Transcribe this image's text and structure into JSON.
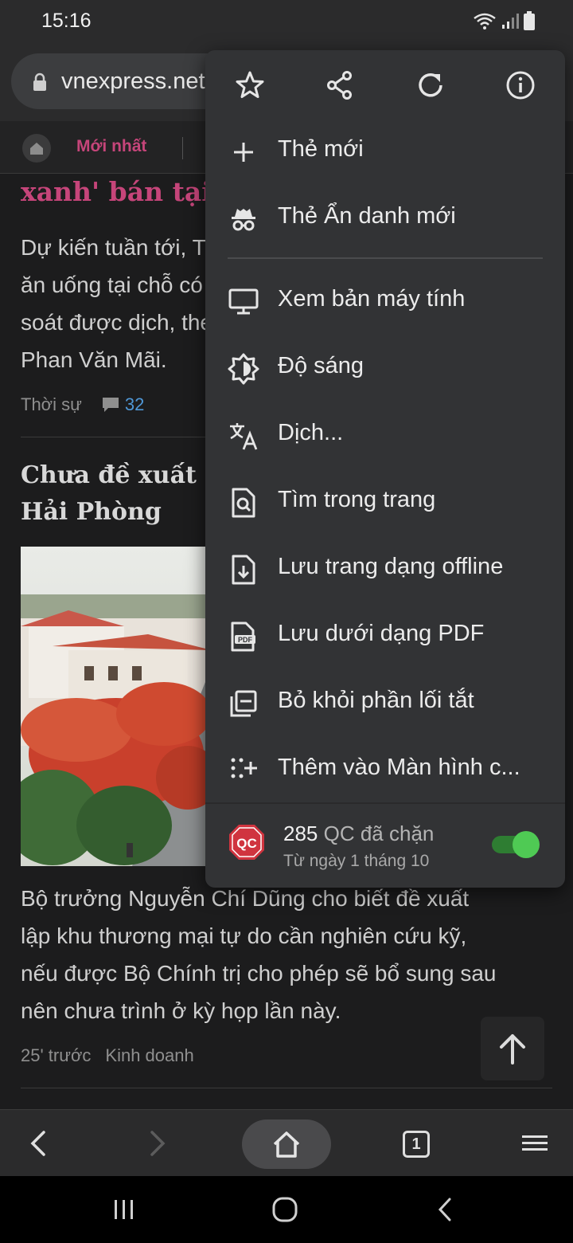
{
  "status_bar": {
    "time": "15:16"
  },
  "address_bar": {
    "url": "vnexpress.net"
  },
  "site_nav": {
    "latest": "Mới nhất"
  },
  "content": {
    "lead_title": "xanh' bán tại chỗ",
    "lead_paragraph": [
      "Dự kiến tuần tới, TP HCM cho phép",
      "ăn uống tại chỗ có điều kiện nếu kiểm",
      "soát được dịch, theo Phó chủ tịch",
      "Phan Văn Mãi."
    ],
    "lead_category": "Thời sự",
    "lead_comments": "32",
    "article_title": [
      "Chưa đề xuất lập khu thương mại tự do",
      "Hải Phòng"
    ],
    "article_paragraph": [
      "Bộ trưởng Nguyễn Chí Dũng cho biết đề xuất",
      "lập khu thương mại tự do cần nghiên cứu kỹ,",
      "nếu được Bộ Chính trị cho phép sẽ bổ sung sau",
      "nên chưa trình ở kỳ họp lần này."
    ],
    "article_time": "25' trước",
    "article_category": "Kinh doanh"
  },
  "menu": {
    "top_icons": [
      "star-icon",
      "share-icon",
      "refresh-icon",
      "info-icon"
    ],
    "items": [
      {
        "icon": "plus-icon",
        "label": "Thẻ mới"
      },
      {
        "icon": "incognito-icon",
        "label": "Thẻ Ẩn danh mới"
      },
      {
        "icon": "desktop-icon",
        "label": "Xem bản máy tính"
      },
      {
        "icon": "brightness-icon",
        "label": "Độ sáng"
      },
      {
        "icon": "translate-icon",
        "label": "Dịch..."
      },
      {
        "icon": "find-in-page-icon",
        "label": "Tìm trong trang"
      },
      {
        "icon": "download-page-icon",
        "label": "Lưu trang dạng offline"
      },
      {
        "icon": "pdf-icon",
        "label": "Lưu dưới dạng PDF"
      },
      {
        "icon": "remove-shortcut-icon",
        "label": "Bỏ khỏi phần lối tắt"
      },
      {
        "icon": "add-home-icon",
        "label": "Thêm vào Màn hình c..."
      }
    ],
    "adblock": {
      "badge": "QC",
      "count": "285",
      "count_label": "QC đã chặn",
      "since": "Từ ngày 1 tháng 10",
      "enabled": true
    }
  },
  "toolbar": {
    "tab_count": "1"
  },
  "colors": {
    "accent_pink": "#c6457a",
    "link_blue": "#4f97d6",
    "toggle_green": "#4fca54",
    "adblock_red": "#d0343f"
  }
}
